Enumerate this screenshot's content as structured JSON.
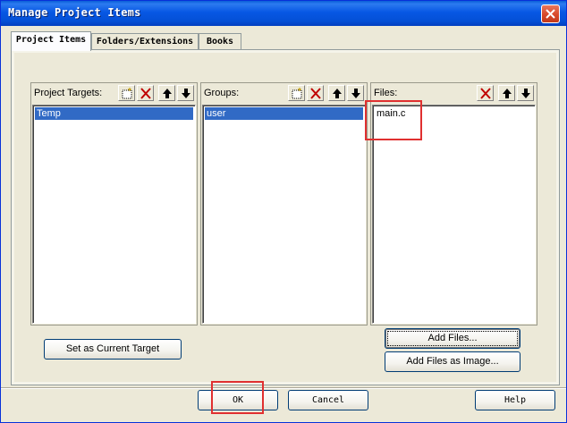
{
  "window": {
    "title": "Manage Project Items"
  },
  "tabs": [
    {
      "label": "Project Items",
      "active": true
    },
    {
      "label": "Folders/Extensions",
      "active": false
    },
    {
      "label": "Books",
      "active": false
    }
  ],
  "targets": {
    "label": "Project Targets:",
    "items": [
      "Temp"
    ],
    "selected": "Temp"
  },
  "groups": {
    "label": "Groups:",
    "items": [
      "user"
    ],
    "selected": "user"
  },
  "files": {
    "label": "Files:",
    "items": [
      "main.c"
    ]
  },
  "buttons": {
    "set_current_target": "Set as Current Target",
    "add_files": "Add Files...",
    "add_files_as_image": "Add Files as Image...",
    "ok": "OK",
    "cancel": "Cancel",
    "help": "Help"
  },
  "icons": {
    "new": "new-item-icon",
    "delete": "delete-icon",
    "up": "move-up-icon",
    "down": "move-down-icon",
    "close": "close-icon"
  },
  "colors": {
    "title_bar": "#0757e4",
    "selection": "#316ac5",
    "highlight_box": "#e03030",
    "close_button": "#d8492a"
  }
}
